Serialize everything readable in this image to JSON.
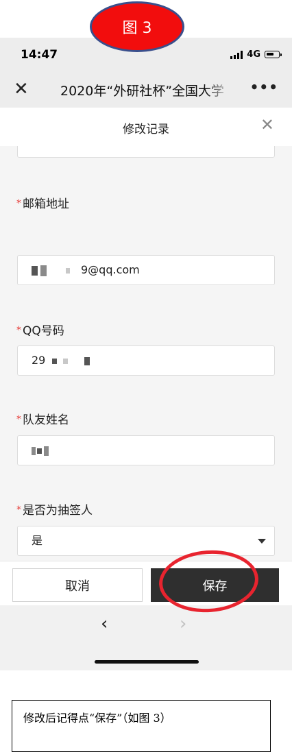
{
  "figure_label": "图 3",
  "status_bar": {
    "time": "14:47",
    "network": "4G"
  },
  "navbar": {
    "close_icon": "close-icon",
    "title": "2020年“外研社杯”全国大学",
    "more_icon": "more-icon"
  },
  "modal": {
    "title": "修改记录",
    "close_icon": "close-icon"
  },
  "form": {
    "fields": [
      {
        "label": "邮箱地址",
        "value": "9@qq.com",
        "required_mark": "*"
      },
      {
        "label": "QQ号码",
        "value": "29",
        "required_mark": "*"
      },
      {
        "label": "队友姓名",
        "value": "",
        "required_mark": "*"
      },
      {
        "label": "是否为抽签人",
        "value": "是",
        "required_mark": "*"
      }
    ]
  },
  "footer": {
    "cancel_label": "取消",
    "save_label": "保存"
  },
  "bottom_nav": {
    "back_icon": "chevron-left-icon",
    "forward_icon": "chevron-right-icon"
  },
  "caption": "修改后记得点“保存”（如图 3）",
  "colors": {
    "highlight_ring": "#e8242f",
    "label_oval": "#f20d0d",
    "oval_border": "#3a4f8c",
    "save_button": "#2f2f2f",
    "required": "#e53935"
  }
}
